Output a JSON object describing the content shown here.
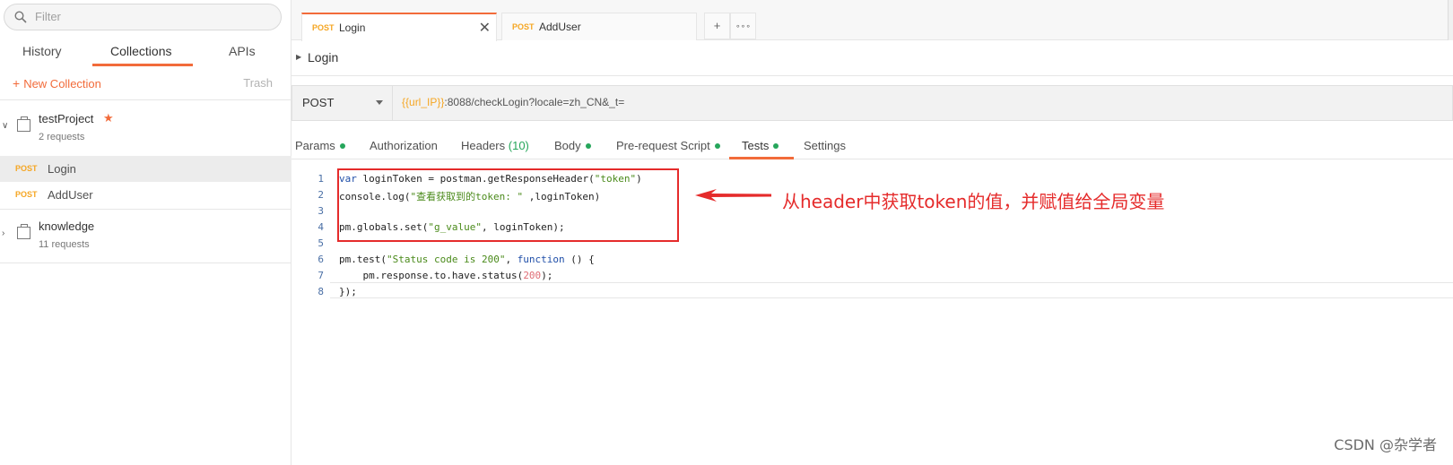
{
  "sidebar": {
    "filter_placeholder": "Filter",
    "tabs": [
      "History",
      "Collections",
      "APIs"
    ],
    "new_collection": "New Collection",
    "trash": "Trash",
    "collections": [
      {
        "name": "testProject",
        "count": "2 requests"
      },
      {
        "name": "knowledge",
        "count": "11 requests"
      }
    ],
    "requests": [
      {
        "method": "POST",
        "name": "Login"
      },
      {
        "method": "POST",
        "name": "AddUser"
      }
    ]
  },
  "tabs": [
    {
      "method": "POST",
      "name": "Login"
    },
    {
      "method": "POST",
      "name": "AddUser"
    }
  ],
  "tab_buttons": {
    "add": "+",
    "more": "∘∘∘"
  },
  "request": {
    "name": "Login",
    "method": "POST",
    "url_var": "{{url_IP}}",
    "url_rest": ":8088/checkLogin?locale=zh_CN&_t="
  },
  "subtabs": {
    "params": "Params",
    "authorization": "Authorization",
    "headers": "Headers",
    "headers_count": "(10)",
    "body": "Body",
    "prerequest": "Pre-request Script",
    "tests": "Tests",
    "settings": "Settings"
  },
  "editor": {
    "line_numbers": [
      "1",
      "2",
      "3",
      "4",
      "5",
      "6",
      "7",
      "8"
    ]
  },
  "annotation": "从header中获取token的值，并赋值给全局变量",
  "watermark": "CSDN @杂学者",
  "colors": {
    "accent": "#f26b3a",
    "method": "#f5a623",
    "status_dot": "#26a65b",
    "annotation": "#e52b2b"
  }
}
